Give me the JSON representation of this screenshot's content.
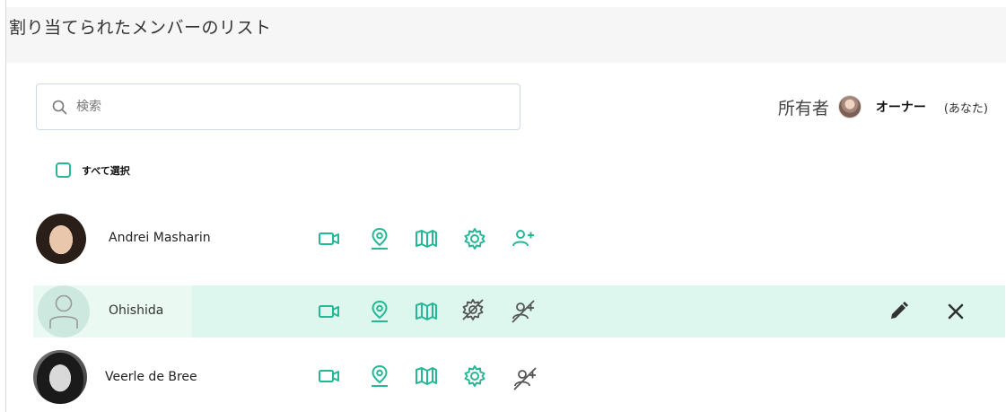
{
  "header": {
    "title": "割り当てられたメンバーのリスト"
  },
  "search": {
    "placeholder": "検索"
  },
  "owner": {
    "label": "所有者",
    "name": "オーナー",
    "suffix": "(あなた)"
  },
  "select_all": {
    "label": "すべて選択",
    "checked": false
  },
  "members": [
    {
      "name": "Andrei Masharin",
      "avatar": "photo",
      "permissions": {
        "video": true,
        "location": true,
        "map": true,
        "settings": true,
        "add_user": true
      }
    },
    {
      "name": "Ohishida",
      "avatar": "placeholder",
      "selected": true,
      "permissions": {
        "video": true,
        "location": true,
        "map": true,
        "settings": false,
        "add_user": false
      }
    },
    {
      "name": "Veerle de Bree",
      "avatar": "photo",
      "permissions": {
        "video": true,
        "location": true,
        "map": true,
        "settings": true,
        "add_user": false
      }
    }
  ],
  "row_actions": [
    "edit-icon",
    "close-icon"
  ],
  "colors": {
    "accent": "#26b796",
    "selected_row": "#ddf7ee",
    "disabled_icon": "#555555"
  }
}
